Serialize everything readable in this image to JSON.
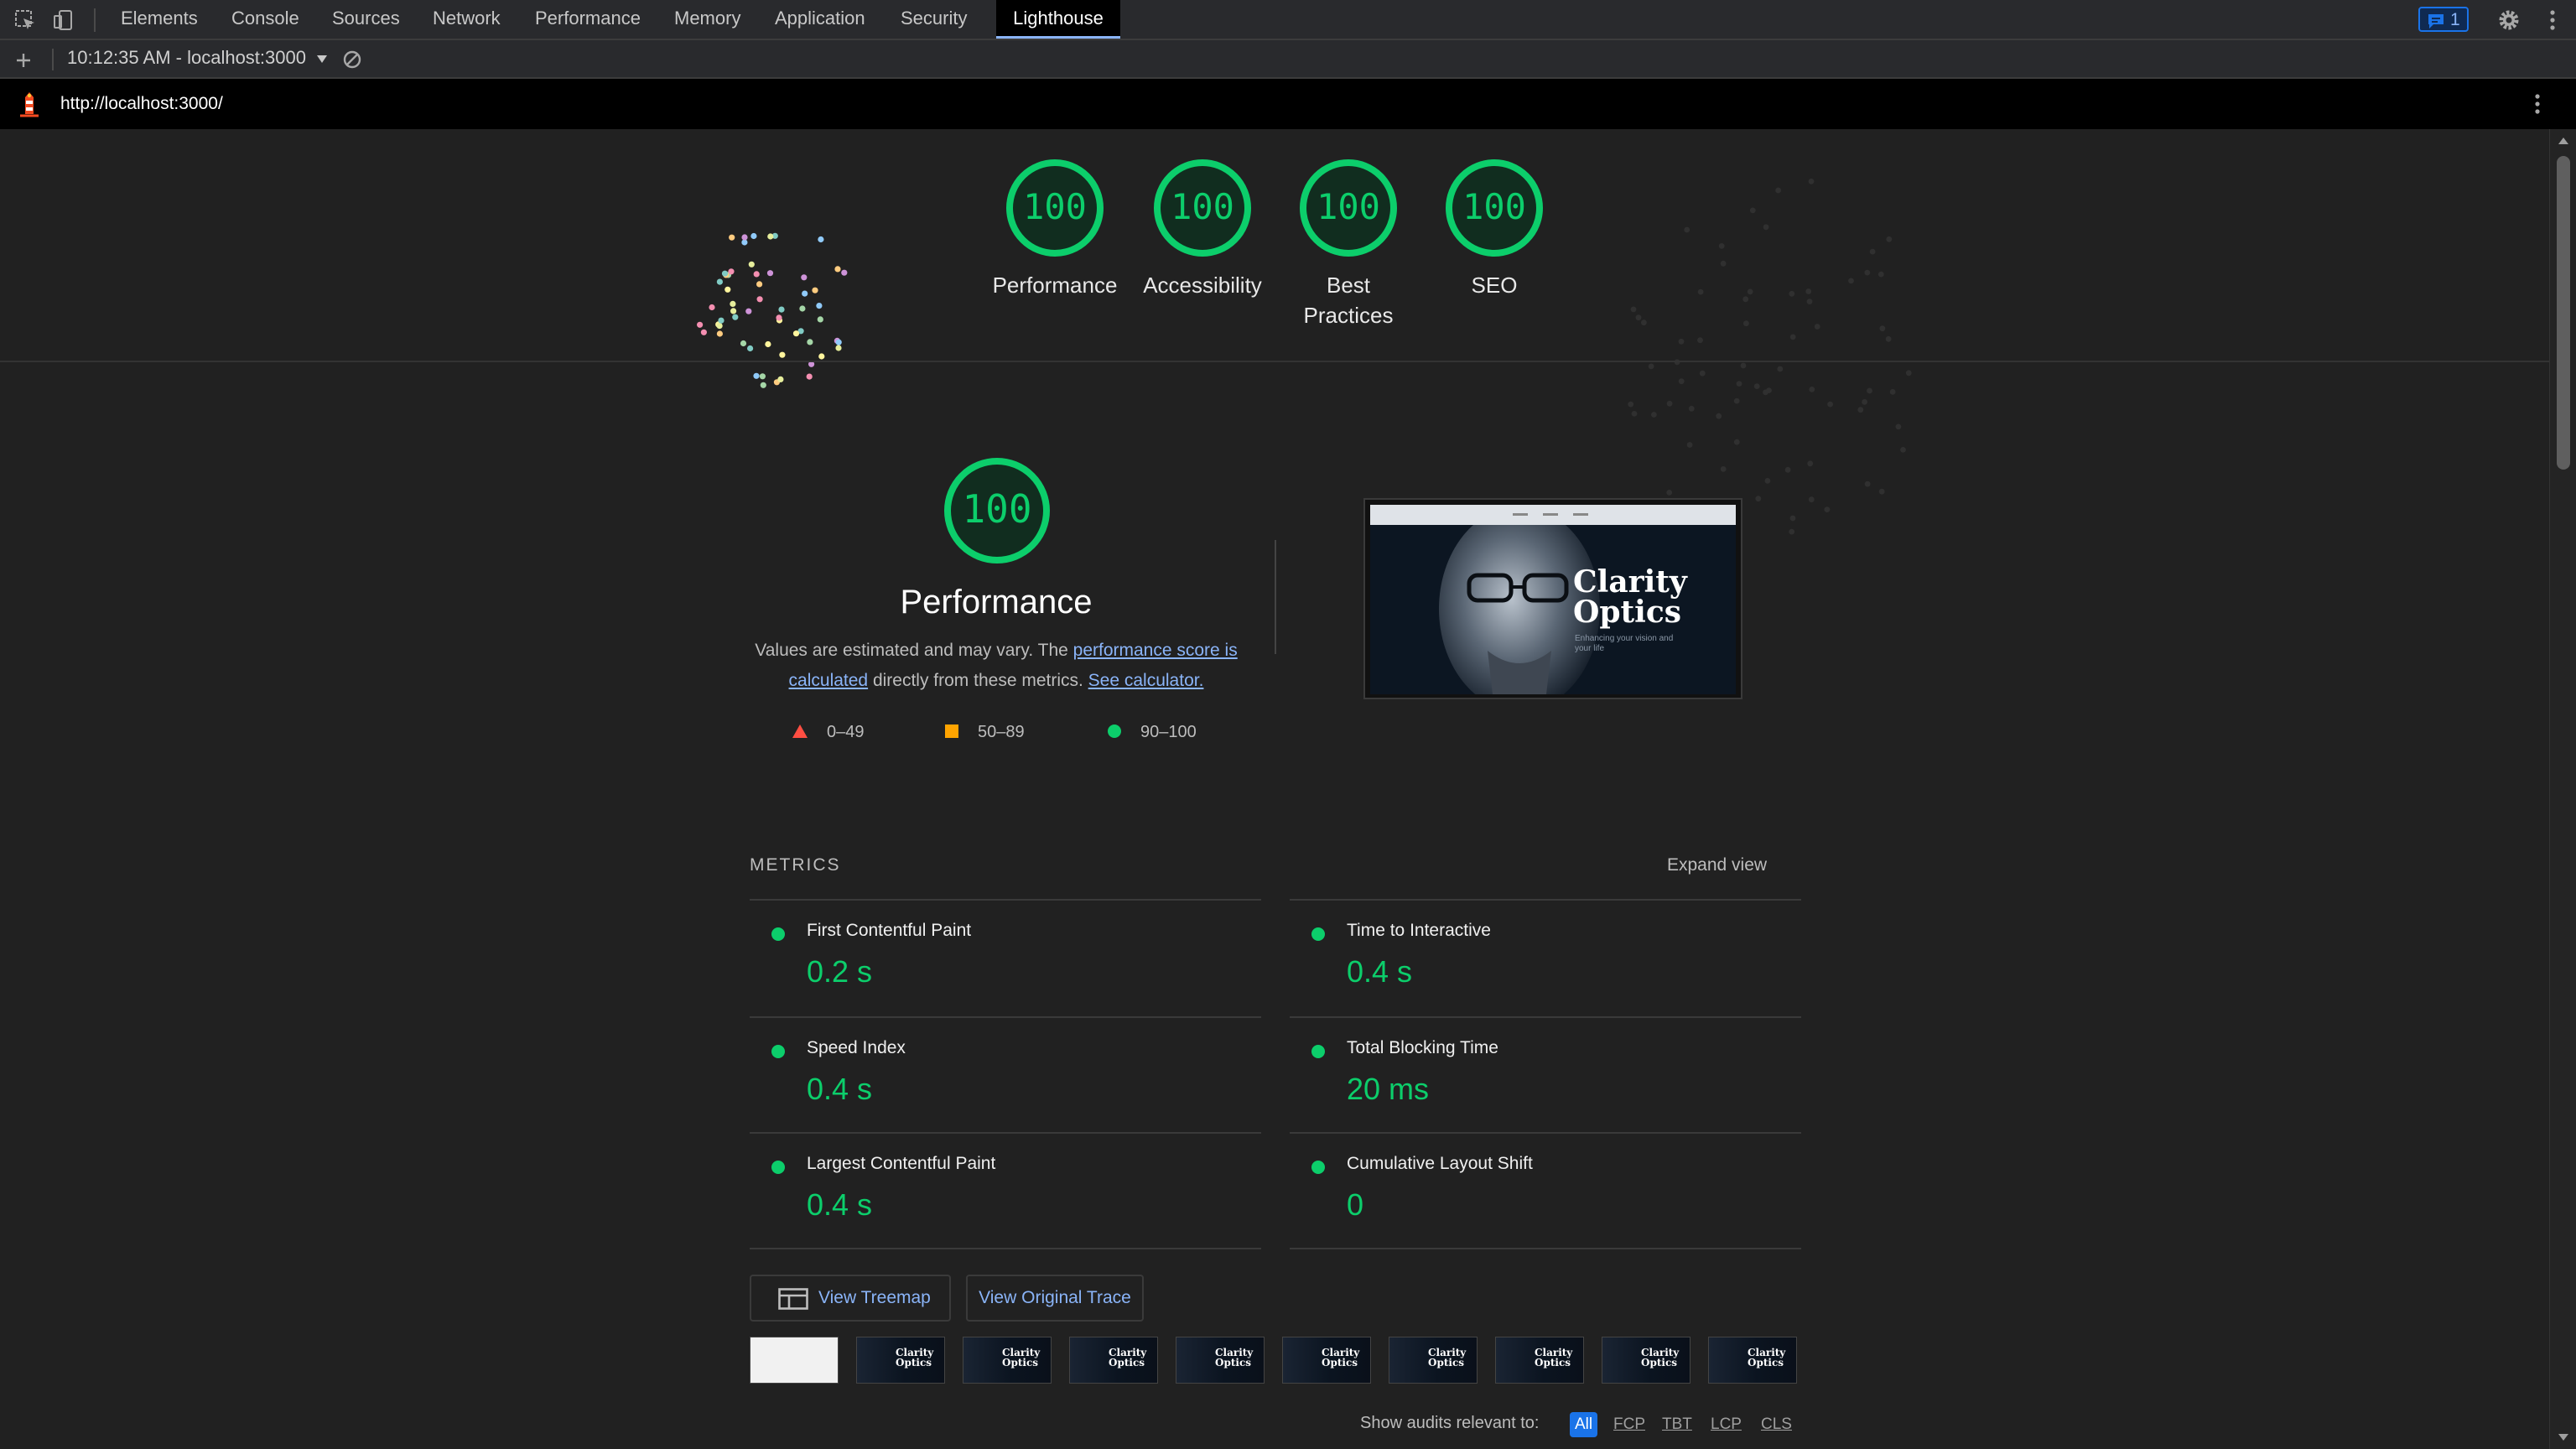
{
  "devtools": {
    "tabs": [
      {
        "label": "Elements"
      },
      {
        "label": "Console"
      },
      {
        "label": "Sources"
      },
      {
        "label": "Network"
      },
      {
        "label": "Performance"
      },
      {
        "label": "Memory"
      },
      {
        "label": "Application"
      },
      {
        "label": "Security"
      },
      {
        "label": "Lighthouse",
        "active": true
      }
    ],
    "issues_count": "1",
    "icons": [
      "inspect-element-icon",
      "device-toolbar-icon",
      "issues-icon",
      "settings-gear-icon",
      "more-vert-icon"
    ]
  },
  "report_bar": {
    "selected_report": "10:12:35 AM - localhost:3000",
    "icons": [
      "add-icon",
      "dropdown-arrow-icon",
      "clear-icon"
    ]
  },
  "url_bar": {
    "url": "http://localhost:3000/",
    "icons": [
      "lighthouse-logo-icon",
      "more-vert-icon"
    ]
  },
  "summary_gauges": [
    {
      "score": "100",
      "label": "Performance"
    },
    {
      "score": "100",
      "label": "Accessibility"
    },
    {
      "score": "100",
      "label": "Best Practices"
    },
    {
      "score": "100",
      "label": "SEO"
    }
  ],
  "performance": {
    "score": "100",
    "title": "Performance",
    "desc_prefix": "Values are estimated and may vary. The ",
    "link_score": "performance score is calculated",
    "desc_mid": " directly from these metrics. ",
    "link_calculator": "See calculator.",
    "legend": [
      {
        "range": "0–49",
        "shape": "triangle",
        "color": "#ff4e42"
      },
      {
        "range": "50–89",
        "shape": "square",
        "color": "#ffa400"
      },
      {
        "range": "90–100",
        "shape": "circle",
        "color": "#0cce6b"
      }
    ]
  },
  "screenshot": {
    "title_line1": "Clarity",
    "title_line2": "Optics",
    "subtitle": "Enhancing your vision and your life"
  },
  "metrics": {
    "heading": "METRICS",
    "expand_label": "Expand view",
    "items": [
      {
        "title": "First Contentful Paint",
        "value": "0.2 s"
      },
      {
        "title": "Time to Interactive",
        "value": "0.4 s"
      },
      {
        "title": "Speed Index",
        "value": "0.4 s"
      },
      {
        "title": "Total Blocking Time",
        "value": "20 ms"
      },
      {
        "title": "Largest Contentful Paint",
        "value": "0.4 s"
      },
      {
        "title": "Cumulative Layout Shift",
        "value": "0"
      }
    ],
    "status_color": "#0cce6b"
  },
  "actions": {
    "view_treemap": "View Treemap",
    "view_trace": "View Original Trace"
  },
  "filmstrip": {
    "frames": 10,
    "frame_text": "Clarity Optics"
  },
  "audit_filter": {
    "label": "Show audits relevant to:",
    "options": [
      "All",
      "FCP",
      "TBT",
      "LCP",
      "CLS"
    ],
    "selected": "All"
  },
  "colors": {
    "pass_green": "#0cce6b",
    "link_blue": "#8ab4f8",
    "accent_blue": "#1a73e8",
    "background": "#212121"
  }
}
